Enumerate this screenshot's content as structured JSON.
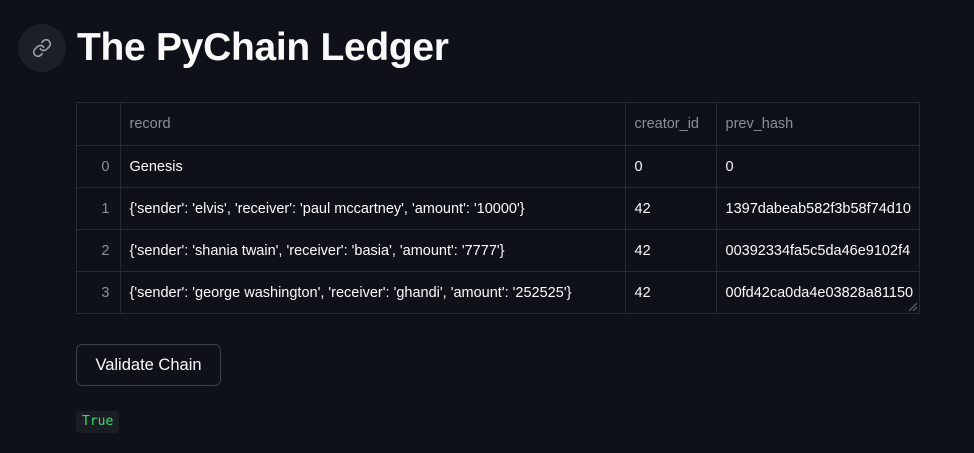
{
  "header": {
    "title": "The PyChain Ledger",
    "anchor_icon": "link-icon"
  },
  "ledger_table": {
    "columns": [
      "",
      "record",
      "creator_id",
      "prev_hash"
    ],
    "rows": [
      {
        "index": "0",
        "record": "Genesis",
        "creator_id": "0",
        "prev_hash": "0"
      },
      {
        "index": "1",
        "record": "{'sender': 'elvis', 'receiver': 'paul mccartney', 'amount': '10000'}",
        "creator_id": "42",
        "prev_hash": "1397dabeab582f3b58f74d10"
      },
      {
        "index": "2",
        "record": "{'sender': 'shania twain', 'receiver': 'basia', 'amount': '7777'}",
        "creator_id": "42",
        "prev_hash": "00392334fa5c5da46e9102f4"
      },
      {
        "index": "3",
        "record": "{'sender': 'george washington', 'receiver': 'ghandi', 'amount': '252525'}",
        "creator_id": "42",
        "prev_hash": "00fd42ca0da4e03828a81150"
      }
    ]
  },
  "actions": {
    "validate_label": "Validate Chain"
  },
  "result": {
    "value": "True"
  },
  "colors": {
    "background": "#0e1117",
    "text": "#fafafa",
    "muted": "#8a8f98",
    "success_code": "#3dd56d"
  }
}
